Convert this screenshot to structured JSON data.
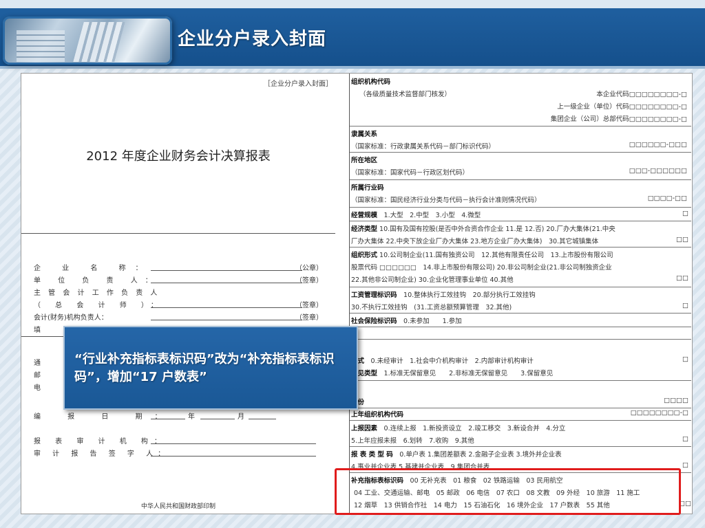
{
  "header": {
    "title": "企业分户录入封面"
  },
  "left": {
    "cover_tag": "［企业分户录入封面］",
    "report_title": "2012 年度企业财务会计决算报表",
    "fields": [
      {
        "label": "企 业 名 称：",
        "suffix": "（公章）"
      },
      {
        "label": "单 位 负 责 人：",
        "suffix": "（签章）"
      },
      {
        "label": "主 管 会 计 工 作 负 责 人",
        "suffix": ""
      },
      {
        "label": "（ 总 会 计 师 ）：",
        "suffix": "（签章）"
      },
      {
        "label": "会计(财务)机构负责人：",
        "suffix": "（签章）"
      },
      {
        "label": "填",
        "suffix": ""
      },
      {
        "label": "通",
        "suffix": ""
      },
      {
        "label": "邮",
        "suffix": ""
      },
      {
        "label": "电",
        "suffix": ""
      },
      {
        "label": "编 报 日 期：",
        "suffix": "",
        "mid1": "年",
        "mid2": "月"
      },
      {
        "label": "报 表 审 计 机 构：",
        "suffix": ""
      },
      {
        "label": "审 计 报 告 签 字 人：",
        "suffix": ""
      }
    ],
    "printer": "中华人民共和国财政部印制"
  },
  "right": {
    "org_code_title": "组织机构代码",
    "org_code_note": "（各级质量技术监督部门核发）",
    "org_code_self": "本企业代码□□□□□□□□-□",
    "org_code_parent": "上一级企业（单位）代码□□□□□□□□-□",
    "org_code_group": "集团企业（公司）总部代码□□□□□□□□-□",
    "affil_title": "隶属关系",
    "affil_note": "（国家标准：行政隶属关系代码－部门标识代码）",
    "affil_boxes": "□□□□□□-□□□",
    "region_title": "所在地区",
    "region_note": "（国家标准：国家代码－行政区划代码）",
    "region_boxes": "□□□-□□□□□□",
    "industry_title": "所属行业码",
    "industry_note": "（国家标准：国民经济行业分类与代码－执行会计准则情况代码）",
    "industry_boxes": "□□□□-□□",
    "scale_title": "经营规模",
    "scale_opts": "1.大型　2.中型　3.小型　4.微型",
    "box1": "□",
    "econ_title": "经济类型",
    "econ_line1": "10.国有及国有控股(是否中外合资合作企业 11.是 12.否) 20.厂办大集体(21.中央",
    "econ_line2": "厂办大集体 22.中央下放企业厂办大集体 23.地方企业厂办大集体)　30.其它城镇集体",
    "box2": "□□",
    "form_title": "组织形式",
    "form_line1": "10.公司制企业(11.国有独资公司　12.其他有限责任公司　13.上市股份有限公司",
    "form_line2": "股票代码 □□□□□□　14.非上市股份有限公司) 20.非公司制企业(21.非公司制独资企业",
    "form_line3": "22.其他非公司制企业) 30.企业化管理事业单位 40.其他",
    "wage_title": "工资管理标识码",
    "wage_line1": "10.整体执行工效挂钩　20.部分执行工效挂钩",
    "wage_line2": "30.不执行工效挂钩　(31.工资总额预算管理　32.其他)",
    "social_title": "社会保险标识码",
    "social_opts": "0.未参加　　1.参加",
    "audit_title": "方式",
    "audit_opts": "0.未经审计　1.社会中介机构审计　2.内部审计机构审计",
    "opinion_title": "意见类型",
    "opinion_opts": "1.标准无保留意见　　2.非标准无保留意见　　3.保留意见",
    "year_title": "年份",
    "box4": "□□□□",
    "prev_org_title": "上年组织机构代码",
    "prev_org_boxes": "□□□□□□□□-□",
    "reason_title": "上报因素",
    "reason_line1": "0.连续上报　1.新投资设立　2.竣工移交　3.新设合并　4.分立",
    "reason_line2": "5.上年应报未报　6.划转　7.收购　9.其他",
    "type_title": "报 表 类 型 码",
    "type_line1": "0.单户表 1.集团差额表 2.金融子企业表 3.境外并企业表",
    "type_line2": "4.事业并企业表 5.基建并企业表　9.集团合并表",
    "supp_title": "补充指标表标识码",
    "supp_line1": "00 无补充表　01 粮食　02 铁路运输　03 民用航空",
    "supp_line2": "04 工业、交通运输、邮电　05 邮政　06 电信　07 农口　08 文教　09 外经　10 旅游　11 施工",
    "supp_line3": "12 烟草　13 供销合作社　14 电力　15 石油石化　16 境外企业　17 户数表　55 其他"
  },
  "callout": {
    "text": "“行业补充指标表标识码”改为“补充指标表标识码”，增加“17 户数表”"
  }
}
